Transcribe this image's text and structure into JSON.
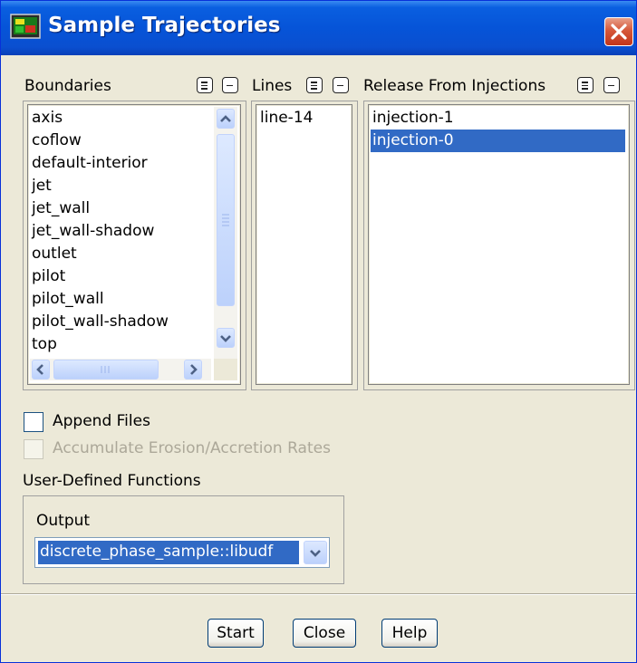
{
  "window": {
    "title": "Sample Trajectories"
  },
  "boundaries": {
    "label": "Boundaries",
    "items": [
      "axis",
      "coflow",
      "default-interior",
      "jet",
      "jet_wall",
      "jet_wall-shadow",
      "outlet",
      "pilot",
      "pilot_wall",
      "pilot_wall-shadow",
      "top"
    ]
  },
  "lines": {
    "label": "Lines",
    "items": [
      "line-14"
    ]
  },
  "injections": {
    "label": "Release From Injections",
    "items": [
      "injection-1",
      "injection-0"
    ],
    "selected": "injection-0"
  },
  "options": {
    "append_files": "Append Files",
    "accumulate": "Accumulate Erosion/Accretion Rates"
  },
  "udf": {
    "group_label": "User-Defined Functions",
    "output_label": "Output",
    "output_value": "discrete_phase_sample::libudf"
  },
  "buttons": {
    "start": "Start",
    "close": "Close",
    "help": "Help"
  },
  "colors": {
    "selection": "#316ac5",
    "titlebar": "#0654d8"
  }
}
